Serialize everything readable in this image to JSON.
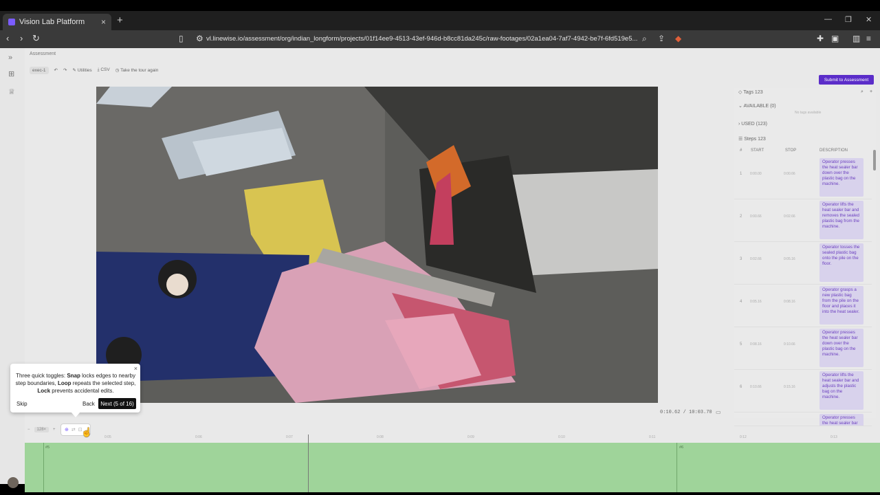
{
  "browser": {
    "tab_title": "Vision Lab Platform",
    "tab_close": "×",
    "new_tab": "+",
    "url": "vl.linewise.io/assessment/org/indian_longform/projects/01f14ee9-4513-43ef-946d-b8cc81da245c/raw-footages/02a1ea04-7af7-4942-be7f-6fd519e5..."
  },
  "app": {
    "breadcrumb": "Assessment",
    "toolbar": {
      "version": "exec-1",
      "utilities": "Utilities",
      "csv": "CSV",
      "tour": "Take the tour again"
    },
    "submit_label": "Submit to Assessment",
    "timecode": "0:10.62 / 10:03.70",
    "right_panel": {
      "tags_label": "Tags 123",
      "available": "AVAILABLE (0)",
      "available_empty": "No tags available",
      "used": "USED (123)",
      "steps_label": "Steps 123",
      "columns": [
        "#",
        "START",
        "STOP",
        "DESCRIPTION"
      ],
      "steps": [
        {
          "num": "1",
          "start": "0:00.00",
          "stop": "0:00.66",
          "desc": "Operator presses the heat sealer bar down over the plastic bag on the machine."
        },
        {
          "num": "2",
          "start": "0:00.66",
          "stop": "0:02.66",
          "desc": "Operator lifts the heat sealer bar and removes the sealed plastic bag from the machine."
        },
        {
          "num": "3",
          "start": "0:02.66",
          "stop": "0:05.16",
          "desc": "Operator tosses the sealed plastic bag onto the pile on the floor."
        },
        {
          "num": "4",
          "start": "0:05.16",
          "stop": "0:08.16",
          "desc": "Operator grasps a new plastic bag from the pile on the floor and places it into the heat sealer."
        },
        {
          "num": "5",
          "start": "0:08.16",
          "stop": "0:10.66",
          "desc": "Operator presses the heat sealer bar down over the plastic bag on the machine."
        },
        {
          "num": "6",
          "start": "0:10.66",
          "stop": "0:15.16",
          "desc": "Operator lifts the heat sealer bar and adjusts the plastic bag on the machine."
        },
        {
          "num": "7",
          "start": "",
          "stop": "",
          "desc": "Operator presses the heat sealer bar"
        }
      ]
    },
    "timeline": {
      "zoom": "128×",
      "ruler": [
        "0:05",
        "0:06",
        "0:07",
        "0:08",
        "0:09",
        "0:10",
        "0:11",
        "0:12",
        "0:13",
        "0:14"
      ],
      "markers": [
        "#5",
        "#6"
      ]
    }
  },
  "tour": {
    "text_parts": {
      "a": "Three quick toggles: ",
      "snap": "Snap",
      "b": " locks edges to nearby step boundaries, ",
      "loop": "Loop",
      "c": " repeats the selected step, ",
      "lock": "Lock",
      "d": " prevents accidental edits."
    },
    "skip": "Skip",
    "back": "Back",
    "next": "Next (5 of 16)",
    "close": "×"
  },
  "colors": {
    "accent": "#5b2dc9",
    "track": "#9fd49a",
    "desc_bg": "#d8d2ec"
  }
}
